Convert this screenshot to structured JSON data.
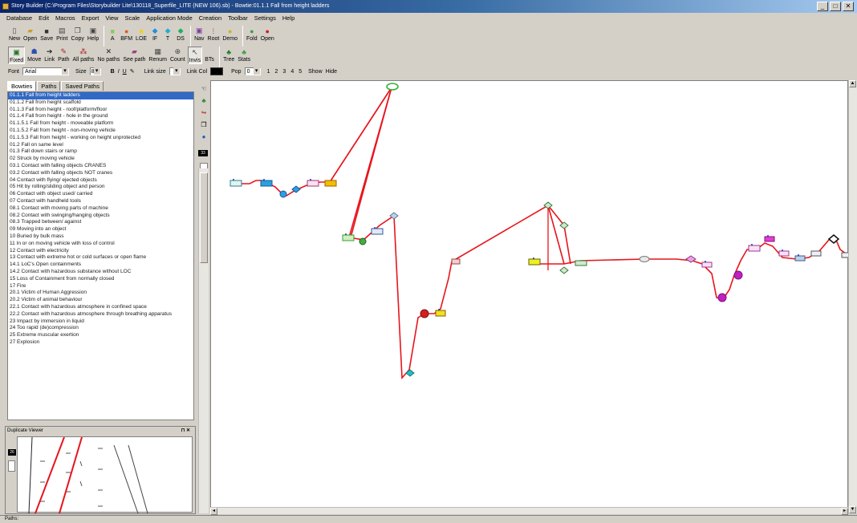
{
  "window": {
    "title": "Story Builder (C:\\Program Files\\Storybuilder Lite\\130118_Superfile_LITE (NEW 106).sb) - Bowtie:01.1.1 Fall from height ladders",
    "minimize": "_",
    "maximize": "□",
    "close": "✕"
  },
  "menu": [
    "Database",
    "Edit",
    "Macros",
    "Export",
    "View",
    "Scale",
    "Application Mode",
    "Creation",
    "Toolbar",
    "Settings",
    "Help"
  ],
  "toolbar1": [
    {
      "label": "New",
      "icon": "new-file-icon"
    },
    {
      "label": "Open",
      "icon": "open-folder-icon"
    },
    {
      "label": "Save",
      "icon": "save-icon"
    },
    {
      "label": "Print",
      "icon": "print-icon"
    },
    {
      "label": "Copy",
      "icon": "copy-icon"
    },
    {
      "label": "Help",
      "icon": "help-icon"
    },
    {
      "sep": true
    },
    {
      "label": "A",
      "icon": "node-a-icon"
    },
    {
      "label": "BFM",
      "icon": "node-bfm-icon"
    },
    {
      "label": "LOE",
      "icon": "node-loe-icon"
    },
    {
      "label": "IF",
      "icon": "node-if-icon"
    },
    {
      "label": "T",
      "icon": "node-t-icon"
    },
    {
      "label": "DS",
      "icon": "node-ds-icon"
    },
    {
      "sep": true
    },
    {
      "label": "Nav",
      "icon": "nav-icon"
    },
    {
      "label": "Root",
      "icon": "root-icon"
    },
    {
      "label": "Demo",
      "icon": "demo-icon"
    },
    {
      "sep": true
    },
    {
      "label": "Fold",
      "icon": "fold-icon"
    },
    {
      "label": "Open",
      "icon": "open-node-icon"
    }
  ],
  "toolbar2": [
    {
      "label": "Fixed",
      "icon": "fixed-icon",
      "pressed": true
    },
    {
      "label": "Move",
      "icon": "move-icon"
    },
    {
      "label": "Link",
      "icon": "link-icon"
    },
    {
      "label": "Path",
      "icon": "path-icon"
    },
    {
      "label": "All paths",
      "icon": "all-paths-icon"
    },
    {
      "label": "No paths",
      "icon": "no-paths-icon"
    },
    {
      "label": "See path",
      "icon": "see-path-icon"
    },
    {
      "label": "Renum",
      "icon": "renum-icon"
    },
    {
      "label": "Count",
      "icon": "count-icon"
    },
    {
      "label": "Invis",
      "icon": "invis-icon",
      "pressed": true
    },
    {
      "label": "BTs",
      "icon": "bts-icon"
    },
    {
      "sep": true
    },
    {
      "label": "Tree",
      "icon": "tree-icon"
    },
    {
      "label": "Stats",
      "icon": "stats-icon"
    }
  ],
  "toolbar3": {
    "font_label": "Font",
    "font_value": "Arial",
    "size_label": "Size",
    "size_value": "8",
    "bold": "B",
    "italic": "I",
    "underline": "U",
    "link_size_label": "Link size",
    "link_col_label": "Link Col",
    "link_color": "#000000",
    "pop_label": "Pop",
    "pop_value": "0",
    "levels": [
      "1",
      "2",
      "3",
      "4",
      "5"
    ],
    "show": "Show",
    "hide": "Hide"
  },
  "tabs": [
    "Bowties",
    "Paths",
    "Saved Paths"
  ],
  "bowties": [
    "01.1.1 Fall from height ladders",
    "01.1.2 Fall from height scaffold",
    "01.1.3 Fall from height - roof/platform/floor",
    "01.1.4 Fall from height - hole in the ground",
    "01.1.5.1 Fall from height - moveable platform",
    "01.1.5.2 Fall from height - non-moving vehicle",
    "01.1.5.3 Fall from height - working on height unprotected",
    "01.2 Fall on same level",
    "01.3 Fall down stairs or ramp",
    "02 Struck by moving vehicle",
    "03.1 Contact with falling objects CRANES",
    "03.2 Contact with falling objects NOT cranes",
    "04 Contact with flying/ ejected objects",
    "05 Hit by rolling/sliding object and person",
    "06 Contact with object used/ carried",
    "07 Contact with handheld tools",
    "08.1 Contact with moving parts of machine",
    "08.2 Contact with swinging/hanging objects",
    "08.3 Trapped between/ against",
    "09 Moving into an object",
    "10 Buried by bulk mass",
    "11 In or on moving vehicle with loss of control",
    "12 Contact with electricity",
    "13 Contact with extreme hot or cold surfaces or open flame",
    "14.1 LoC's Open containments",
    "14.2 Contact with hazardous substance without LOC",
    "15 Loss of Containment from normally closed",
    "17 Fire",
    "20.1 Victim of Human Aggression",
    "20.2 Victim of animal behaviour",
    "22.1 Contact with hazardous atmosphere in confined space",
    "22.2 Contact with hazardous atmosphere through breathing apparatus",
    "23 Impact by immersion in liquid",
    "24 Too rapid (de)compression",
    "25 Extreme muscular exertion",
    "27 Explosion"
  ],
  "zoom_badge": "33",
  "duplicate_viewer": {
    "title": "Duplicate Viewer",
    "pin": "⊓",
    "close": "✕",
    "badge": "26"
  },
  "status": "Paths:",
  "colors": {
    "path": "#e8141c",
    "selection": "#3169c6"
  }
}
